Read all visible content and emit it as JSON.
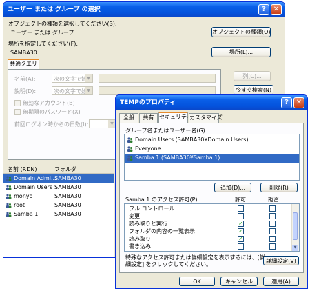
{
  "select_dialog": {
    "title": "ユーザー または グループ の選択",
    "object_type_label": "オブジェクトの種類を選択してください(S):",
    "object_type_value": "ユーザー または グループ",
    "object_type_button": "オブジェクトの種類(O)...",
    "location_label": "場所を指定してください(F):",
    "location_value": "SAMBA30",
    "location_button": "場所(L)...",
    "tab_common_query": "共通クエリ",
    "name_label": "名前(A):",
    "description_label": "説明(D):",
    "combo_value": "次の文字で始",
    "columns_button": "列(C)...",
    "search_button": "今すぐ検索(N)",
    "disabled_accounts": "無効なアカウント(B)",
    "no_expire_password": "無期限のパスワード(X)",
    "last_logon_label": "前回ログオン時からの日数(I):",
    "results_headers": [
      "名前 (RDN)",
      "フォルダ"
    ],
    "results": [
      {
        "name": "Domain Admi...",
        "folder": "SAMBA30",
        "selected": true
      },
      {
        "name": "Domain Users",
        "folder": "SAMBA30",
        "selected": false
      },
      {
        "name": "monyo",
        "folder": "SAMBA30",
        "selected": false
      },
      {
        "name": "root",
        "folder": "SAMBA30",
        "selected": false
      },
      {
        "name": "Samba 1",
        "folder": "SAMBA30",
        "selected": false
      }
    ]
  },
  "props_dialog": {
    "title": "TEMPのプロパティ",
    "tabs": [
      "全般",
      "共有",
      "セキュリティ",
      "カスタマイズ"
    ],
    "active_tab": "セキュリティ",
    "group_label": "グループ名またはユーザー名(G):",
    "principals": [
      {
        "name": "Domain Users (SAMBA30¥Domain Users)",
        "selected": false
      },
      {
        "name": "Everyone",
        "selected": false
      },
      {
        "name": "Samba 1 (SAMBA30¥Samba 1)",
        "selected": true
      }
    ],
    "add_button": "追加(D)...",
    "remove_button": "削除(R)",
    "perm_label": "Samba 1 のアクセス許可(P)",
    "allow_header": "許可",
    "deny_header": "拒否",
    "permissions": [
      {
        "name": "フル コントロール",
        "allow": false,
        "deny": false
      },
      {
        "name": "変更",
        "allow": false,
        "deny": false
      },
      {
        "name": "読み取りと実行",
        "allow": true,
        "deny": false
      },
      {
        "name": "フォルダの内容の一覧表示",
        "allow": true,
        "deny": false
      },
      {
        "name": "読み取り",
        "allow": true,
        "deny": false
      },
      {
        "name": "書き込み",
        "allow": false,
        "deny": false
      }
    ],
    "advanced_text_1": "特殊なアクセス許可または詳細設定を表示するには、[詳",
    "advanced_text_2": "細設定] をクリックしてください。",
    "advanced_button": "詳細設定(V)",
    "ok_button": "OK",
    "cancel_button": "キャンセル",
    "apply_button": "適用(A)"
  }
}
